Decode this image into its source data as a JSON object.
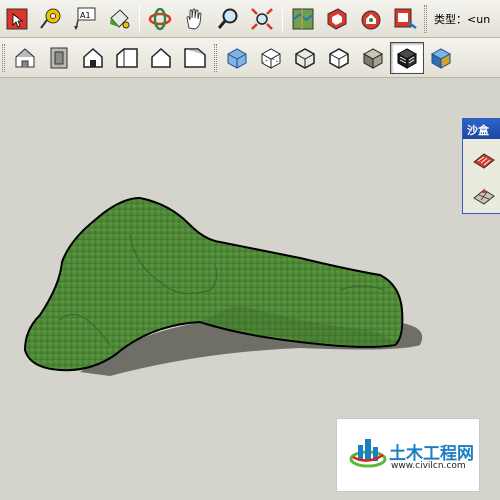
{
  "toolbar_top": {
    "items": [
      {
        "name": "select-icon"
      },
      {
        "name": "tape-measure-icon"
      },
      {
        "name": "text-tool-icon"
      },
      {
        "name": "paint-bucket-icon"
      },
      {
        "name": "orbit-icon"
      },
      {
        "name": "pan-icon"
      },
      {
        "name": "zoom-icon"
      },
      {
        "name": "zoom-extents-icon"
      },
      {
        "name": "add-location-icon"
      },
      {
        "name": "get-models-icon"
      },
      {
        "name": "share-model-icon"
      },
      {
        "name": "send-to-layout-icon"
      }
    ],
    "type_label": "类型：<un"
  },
  "toolbar_views": {
    "view_items": [
      {
        "name": "iso-view-icon"
      },
      {
        "name": "top-view-icon"
      },
      {
        "name": "front-view-icon"
      },
      {
        "name": "right-view-icon"
      },
      {
        "name": "back-view-icon"
      },
      {
        "name": "left-view-icon"
      }
    ],
    "style_items": [
      {
        "name": "xray-icon"
      },
      {
        "name": "back-edges-icon"
      },
      {
        "name": "wireframe-icon"
      },
      {
        "name": "hidden-line-icon"
      },
      {
        "name": "shaded-icon"
      },
      {
        "name": "shaded-textures-icon",
        "pressed": true
      },
      {
        "name": "monochrome-icon"
      }
    ]
  },
  "sandbox_tray": {
    "title": "沙盒",
    "buttons": [
      {
        "name": "sandbox-from-contours-icon"
      },
      {
        "name": "sandbox-from-scratch-icon"
      }
    ]
  },
  "watermark": {
    "brand": "土木工程网",
    "url": "www.civilcn.com",
    "colors": {
      "blue": "#1b7fc4",
      "green": "#5bb53a",
      "red": "#d7261e"
    }
  },
  "colors": {
    "viewport_bg": "#d4d4cc",
    "terrain_green": "#4e8a38",
    "tray_title": "#2d63c8"
  }
}
